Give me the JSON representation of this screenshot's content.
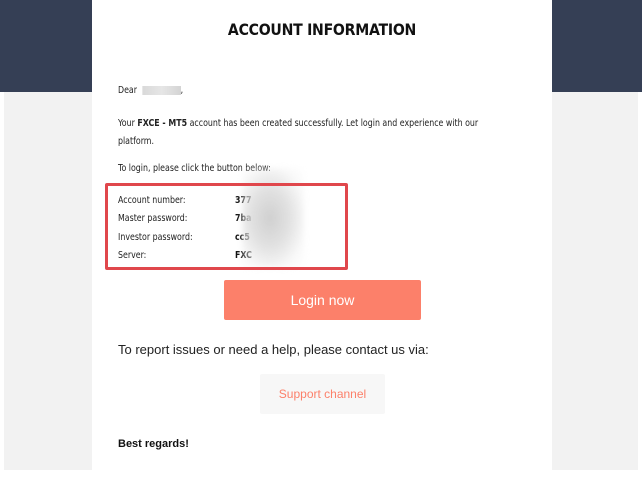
{
  "email": {
    "title": "ACCOUNT INFORMATION",
    "greeting_prefix": "Dear",
    "greeting_suffix": ",",
    "intro_prefix": "Your ",
    "platform_name": "FXCE - MT5",
    "intro_suffix": " account has been created successfully. Let login and experience with our",
    "intro_line2": "platform.",
    "login_prompt": "To login, please click the button below:",
    "credentials": [
      {
        "label": "Account number:",
        "value": "377"
      },
      {
        "label": "Master password:",
        "value": "7ba"
      },
      {
        "label": "Investor password:",
        "value": "cc5"
      },
      {
        "label": "Server:",
        "value": "FXC"
      }
    ],
    "login_button": "Login now",
    "report_text": "To report issues or need a help, please contact us via:",
    "support_button": "Support channel",
    "closing": "Best regards!"
  },
  "colors": {
    "header_band": "#353f55",
    "page_background": "#f2f2f2",
    "accent": "#fc806a",
    "highlight_border": "#e0474c"
  }
}
